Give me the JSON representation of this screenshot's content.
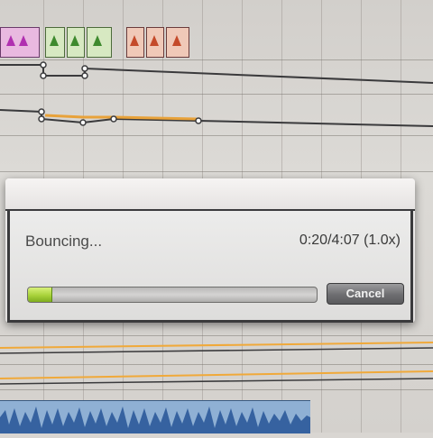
{
  "dialog": {
    "status_text": "Bouncing...",
    "time_readout": "0:20/4:07 (1.0x)",
    "progress_fraction": 0.08,
    "cancel_label": "Cancel"
  },
  "colors": {
    "progress_fill": "#a8d23a",
    "automation_active": "#e8a23a",
    "automation_line": "#3a3a3c",
    "track_highlight": "#f0a93a",
    "waveform_blue": "#2c5a9a"
  },
  "icons": {
    "automation_node": "circle-node-icon",
    "midi_note": "note-triangle-icon"
  }
}
